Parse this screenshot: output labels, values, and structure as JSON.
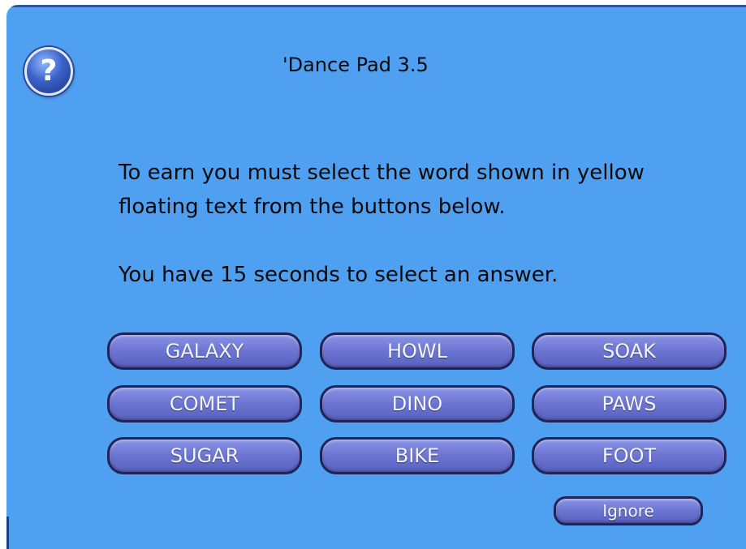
{
  "dialog": {
    "title": "'Dance Pad 3.5",
    "help_icon": "question-mark-icon",
    "message_line1": "To earn you must select the word shown in yellow floating text from the buttons below.",
    "message_line2": "You have 15 seconds to select an answer."
  },
  "buttons": [
    "GALAXY",
    "HOWL",
    "SOAK",
    "COMET",
    "DINO",
    "PAWS",
    "SUGAR",
    "BIKE",
    "FOOT"
  ],
  "ignore_label": "Ignore",
  "colors": {
    "background": "#4fa0f0",
    "button_fill": "#6c74d2",
    "button_border": "#1e2458",
    "button_text": "#f4f6ff"
  }
}
